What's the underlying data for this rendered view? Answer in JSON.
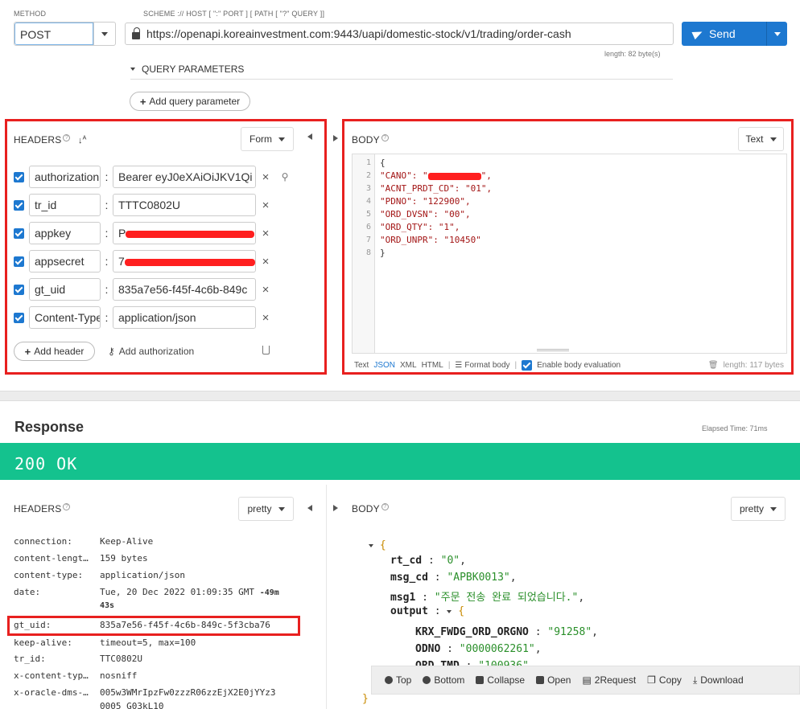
{
  "request": {
    "method_label": "METHOD",
    "method": "POST",
    "url_label": "SCHEME :// HOST [ \":\" PORT ] [ PATH [ \"?\" QUERY ]]",
    "url": "https://openapi.koreainvestment.com:9443/uapi/domestic-stock/v1/trading/order-cash",
    "url_length": "length: 82 byte(s)",
    "send_label": "Send",
    "query_params_label": "QUERY PARAMETERS",
    "add_query_label": "Add query parameter"
  },
  "req_headers": {
    "title": "HEADERS",
    "mode": "Form",
    "rows": [
      {
        "key": "authorization",
        "value": "Bearer eyJ0eXAiOiJKV1Qi"
      },
      {
        "key": "tr_id",
        "value": "TTTC0802U"
      },
      {
        "key": "appkey",
        "value": "P"
      },
      {
        "key": "appsecret",
        "value": "7"
      },
      {
        "key": "gt_uid",
        "value": "835a7e56-f45f-4c6b-849c"
      },
      {
        "key": "Content-Type",
        "value": "application/json"
      }
    ],
    "add_header_label": "Add header",
    "add_auth_label": "Add authorization"
  },
  "req_body": {
    "title": "BODY",
    "mode": "Text",
    "lines": [
      "{",
      "\"CANO\": \"",
      "\"ACNT_PRDT_CD\": \"01\",",
      "\"PDNO\": \"122900\",",
      "\"ORD_DVSN\": \"00\",",
      "\"ORD_QTY\": \"1\",",
      "\"ORD_UNPR\": \"10450\"",
      "}"
    ],
    "line_numbers": [
      "1",
      "2",
      "3",
      "4",
      "5",
      "6",
      "7",
      "8"
    ],
    "formats": [
      "Text",
      "JSON",
      "XML",
      "HTML"
    ],
    "format_body_label": "Format body",
    "enable_eval_label": "Enable body evaluation",
    "length": "length: 117 bytes"
  },
  "response": {
    "title": "Response",
    "elapsed": "Elapsed Time: 71ms",
    "status": "200 OK",
    "headers_title": "HEADERS",
    "headers_mode": "pretty",
    "body_title": "BODY",
    "body_mode": "pretty",
    "headers": [
      {
        "k": "connection:",
        "v": "Keep-Alive"
      },
      {
        "k": "content-lengt…",
        "v": "159 bytes"
      },
      {
        "k": "content-type:",
        "v": "application/json"
      },
      {
        "k": "date:",
        "v": "Tue, 20 Dec 2022 01:09:35 GMT",
        "extra": "-49m",
        "extra2": "43s"
      },
      {
        "k": "gt_uid:",
        "v": "835a7e56-f45f-4c6b-849c-5f3cba76"
      },
      {
        "k": "keep-alive:",
        "v": "timeout=5, max=100"
      },
      {
        "k": "tr_id:",
        "v": "TTC0802U"
      },
      {
        "k": "x-content-typ…",
        "v": "nosniff"
      },
      {
        "k": "x-oracle-dms-…",
        "v": "005w3WMrIpzFw0zzzR06zzEjX2E0jYYz3",
        "v2": "0005 G03kL10"
      }
    ],
    "body": {
      "rt_cd_key": "rt_cd",
      "rt_cd": "\"0\"",
      "msg_cd_key": "msg_cd",
      "msg_cd": "\"APBK0013\"",
      "msg1_key": "msg1",
      "msg1": "\"주문 전송 완료 되었습니다.\"",
      "output_key": "output",
      "krx_key": "KRX_FWDG_ORD_ORGNO",
      "krx": "\"91258\"",
      "odno_key": "ODNO",
      "odno": "\"0000062261\"",
      "ordtmd_key": "ORD_TMD",
      "ordtmd": "\"100936\""
    },
    "toolbar": [
      "Top",
      "Bottom",
      "Collapse",
      "Open",
      "2Request",
      "Copy",
      "Download"
    ]
  }
}
